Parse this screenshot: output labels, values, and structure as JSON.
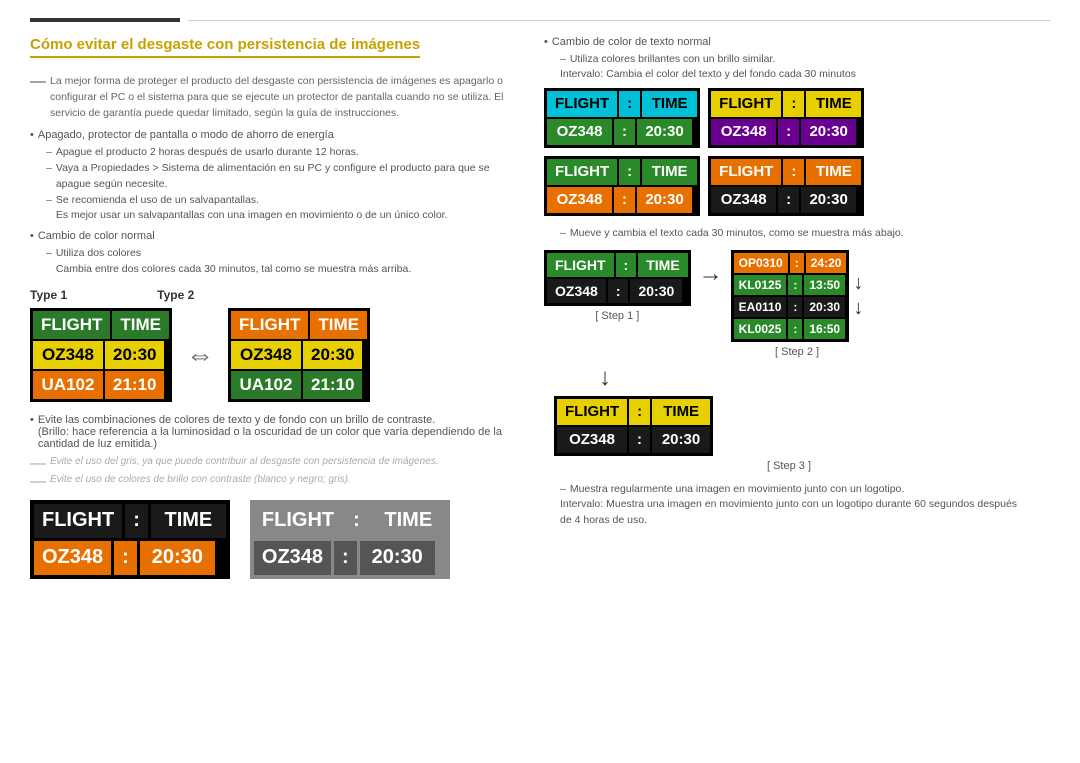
{
  "page": {
    "title": "Cómo evitar el desgaste con persistencia de imágenes"
  },
  "left": {
    "heading": "Cómo evitar el desgaste con persistencia de imágenes",
    "intro": "La mejor forma de proteger el producto del desgaste con persistencia de imágenes es apagarlo o configurar el PC o el sistema para que se ejecute un protector de pantalla cuando no se utiliza. El servicio de garantía puede quedar limitado, según la guía de instrucciones.",
    "bullets": [
      {
        "text": "Apagado, protector de pantalla o modo de ahorro de energía",
        "sub": [
          "Apague el producto 2 horas después de usarlo durante 12 horas.",
          "Vaya a Propiedades > Sistema de alimentación en su PC y configure el producto para que se apague según necesite.",
          "Se recomienda el uso de un salvapantallas.\nEs mejor usar un salvapantallas con una imagen en movimiento o de un único color."
        ]
      },
      {
        "text": "Cambio de color normal",
        "sub": [
          "Utiliza dos colores\nCambia entre dos colores cada 30 minutos, tal como se muestra más arriba."
        ]
      }
    ],
    "type1_label": "Type 1",
    "type2_label": "Type 2",
    "board": {
      "header": [
        "FLIGHT",
        ":",
        "TIME"
      ],
      "rows": [
        [
          "OZ348",
          ":",
          "20:30"
        ],
        [
          "UA102",
          "",
          "21:10"
        ]
      ]
    },
    "avoid_text": "Evite las combinaciones de colores de texto y de fondo con un brillo de contraste.\n(Brillo: hace referencia a la luminosidad o la oscuridad de un color que varía dependiendo de la cantidad de luz emitida.)",
    "gray_note1": "Evite el uso del gris, ya que puede contribuir al desgaste con persistencia de imágenes.",
    "gray_note2": "Evite el uso de colores de brillo con contraste (blanco y negro; gris).",
    "bottom_board1": {
      "header": [
        "FLIGHT",
        ":",
        "TIME"
      ],
      "data": [
        "OZ348",
        ":",
        "20:30"
      ]
    },
    "bottom_board2": {
      "header": [
        "FLIGHT",
        ":",
        "TIME"
      ],
      "data": [
        "OZ348",
        ":",
        "20:30"
      ]
    }
  },
  "right": {
    "note1": "Cambio de color de texto normal",
    "note1_sub1": "Utiliza colores brillantes con un brillo similar.",
    "note1_sub2": "Intervalo: Cambia el color del texto y del fondo cada 30 minutos",
    "boards_grid": [
      {
        "header": [
          "FLIGHT",
          "TIME"
        ],
        "data": "OZ348  :  20:30",
        "style": "cyan_green"
      },
      {
        "header": [
          "FLIGHT",
          "TIME"
        ],
        "data": "OZ348  :  20:30",
        "style": "yellow_purple"
      },
      {
        "header": [
          "FLIGHT",
          "TIME"
        ],
        "data": "OZ348  :  20:30",
        "style": "green_orange"
      },
      {
        "header": [
          "FLIGHT",
          "TIME"
        ],
        "data": "OZ348  :  20:30",
        "style": "orange_dark"
      }
    ],
    "note2": "Mueve y cambia el texto cada 30 minutos, como se muestra más abajo.",
    "step1_label": "[ Step 1 ]",
    "step2_label": "[ Step 2 ]",
    "step3_label": "[ Step 3 ]",
    "step_board1": {
      "header": [
        "FLIGHT",
        "TIME"
      ],
      "data": "OZ348  :  20:30"
    },
    "scroll_rows": [
      "OP0310 : 24:20",
      "KL0125 : 13:50",
      "EA0110 : 20:30",
      "KL0025 : 16:50"
    ],
    "step3_board": {
      "header": [
        "FLIGHT",
        "TIME"
      ],
      "data": "OZ348  :  20:30"
    },
    "note3": "Muestra regularmente una imagen en movimiento junto con un logotipo.",
    "note3_sub": "Intervalo: Muestra una imagen en movimiento junto con un logotipo durante 60 segundos después de 4 horas de uso."
  }
}
